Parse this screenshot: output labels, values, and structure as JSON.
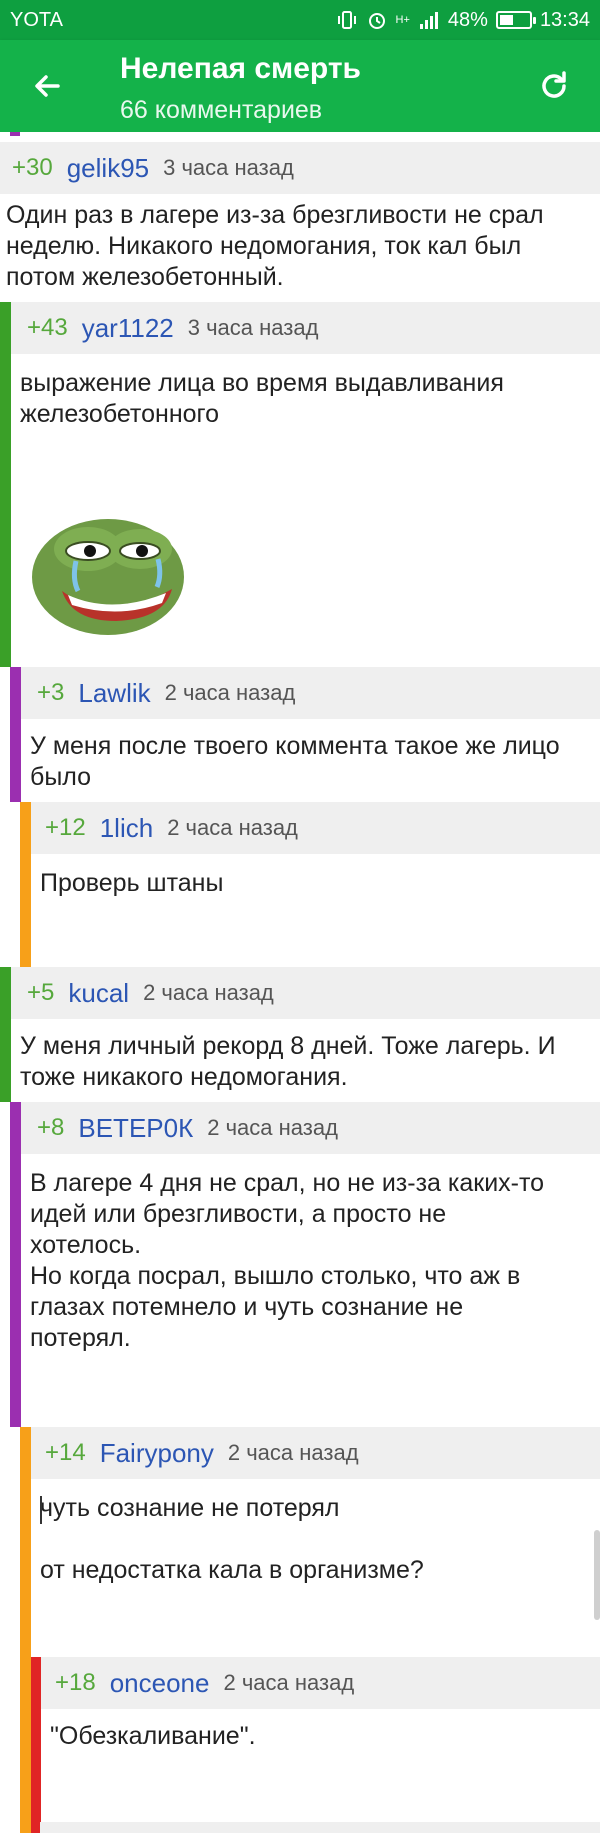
{
  "status": {
    "carrier": "YOTA",
    "network": "H+",
    "battery": "48%",
    "battery_level": 0.48,
    "time": "13:34"
  },
  "appbar": {
    "title": "Нелепая смерть",
    "subtitle": "66 комментариев",
    "back_icon": "arrow-left-icon",
    "refresh_icon": "refresh-icon"
  },
  "colors": {
    "statusbar": "#0e9f40",
    "appbar": "#14b24a",
    "level1": "#3aa028",
    "level2": "#9b2fb0",
    "level3": "#f7a019",
    "level4": "#e02525"
  },
  "comments": [
    {
      "rating": "+30",
      "author": "gelik95",
      "time": "3 часа назад",
      "text": "Один раз в лагере из-за брезгливости не срал неделю. Никакого недомогания, ток кал был потом железобетонный."
    },
    {
      "rating": "+43",
      "author": "yar1122",
      "time": "3 часа назад",
      "text": "выражение лица во время выдавливания железобетонного"
    },
    {
      "rating": "+3",
      "author": "Lawlik",
      "time": "2 часа назад",
      "text": "У меня после твоего коммента такое же лицо было"
    },
    {
      "rating": "+12",
      "author": "1lich",
      "time": "2 часа назад",
      "text": "Проверь штаны"
    },
    {
      "rating": "+5",
      "author": "kucal",
      "time": "2 часа назад",
      "text": "У меня личный рекорд 8 дней. Тоже лагерь. И тоже никакого недомогания."
    },
    {
      "rating": "+8",
      "author": "ВЕТЕР0К",
      "time": "2 часа назад",
      "text": "В лагере 4 дня не срал, но не из-за каких-то идей или брезгливости, а просто не хотелось.\nНо когда посрал, вышло столько, что аж в глазах потемнело и чуть сознание не потерял."
    },
    {
      "rating": "+14",
      "author": "Fairypony",
      "time": "2 часа назад",
      "text": "чуть сознание не потерял\n\nот недостатка кала в организме?"
    },
    {
      "rating": "+18",
      "author": "onceone",
      "time": "2 часа назад",
      "text": "\"Обезкаливание\"."
    }
  ]
}
